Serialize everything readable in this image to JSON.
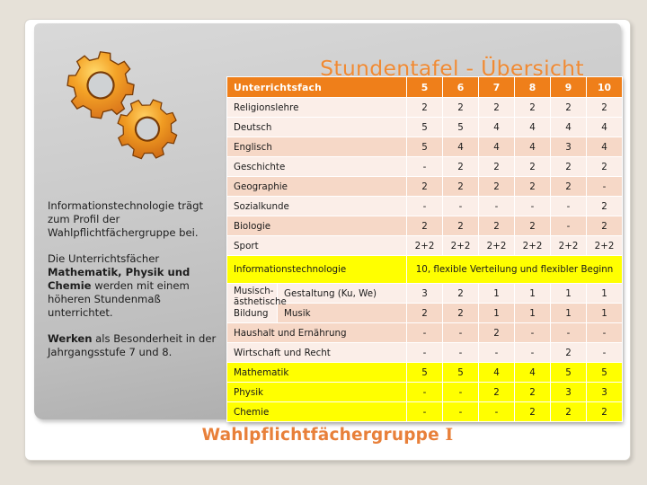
{
  "slide": {
    "title": "Stundentafel - Übersicht",
    "footer_label": "Wahlpflichtfächergruppe",
    "footer_roman": "I",
    "gears_icon": "two-gears-icon",
    "accent_orange": "#ef7f1a",
    "title_orange": "#f08a33",
    "highlight_yellow": "#ffff00",
    "row_light": "#fbeee8",
    "row_dark": "#f6d8c7"
  },
  "left_text": {
    "p1": "Informationstechnologie trägt zum Profil der Wahlpflichtfächergruppe bei.",
    "p2_pre": "Die Unterrichtsfächer ",
    "p2_bold": "Mathematik, Physik und Chemie",
    "p2_post": " werden mit einem höheren Stundenmaß unterrichtet.",
    "p3_bold": "Werken",
    "p3_post": " als Besonderheit in der Jahrgangsstufe 7 und 8."
  },
  "table": {
    "header": {
      "subject": "Unterrichtsfach",
      "grades": [
        "5",
        "6",
        "7",
        "8",
        "9",
        "10"
      ]
    },
    "rows": [
      {
        "subject": "Religionslehre",
        "values": [
          "2",
          "2",
          "2",
          "2",
          "2",
          "2"
        ]
      },
      {
        "subject": "Deutsch",
        "values": [
          "5",
          "5",
          "4",
          "4",
          "4",
          "4"
        ]
      },
      {
        "subject": "Englisch",
        "values": [
          "5",
          "4",
          "4",
          "4",
          "3",
          "4"
        ]
      },
      {
        "subject": "Geschichte",
        "values": [
          "-",
          "2",
          "2",
          "2",
          "2",
          "2"
        ]
      },
      {
        "subject": "Geographie",
        "values": [
          "2",
          "2",
          "2",
          "2",
          "2",
          "-"
        ]
      },
      {
        "subject": "Sozialkunde",
        "values": [
          "-",
          "-",
          "-",
          "-",
          "-",
          "2"
        ]
      },
      {
        "subject": "Biologie",
        "values": [
          "2",
          "2",
          "2",
          "2",
          "-",
          "2"
        ]
      },
      {
        "subject": "Sport",
        "values": [
          "2+2",
          "2+2",
          "2+2",
          "2+2",
          "2+2",
          "2+2"
        ]
      }
    ],
    "it_row": {
      "subject": "Informationstechnologie",
      "note": "10, flexible Verteilung und flexibler Beginn"
    },
    "music_group": {
      "label": "Musisch-ästhetische Bildung",
      "rows": [
        {
          "subject": "Gestaltung (Ku, We)",
          "values": [
            "3",
            "2",
            "1",
            "1",
            "1",
            "1"
          ]
        },
        {
          "subject": "Musik",
          "values": [
            "2",
            "2",
            "1",
            "1",
            "1",
            "1"
          ]
        }
      ]
    },
    "rows_tail": [
      {
        "subject": "Haushalt und Ernährung",
        "values": [
          "-",
          "-",
          "2",
          "-",
          "-",
          "-"
        ]
      },
      {
        "subject": "Wirtschaft und Recht",
        "values": [
          "-",
          "-",
          "-",
          "-",
          "2",
          "-"
        ]
      }
    ],
    "rows_yellow": [
      {
        "subject": "Mathematik",
        "values": [
          "5",
          "5",
          "4",
          "4",
          "5",
          "5"
        ]
      },
      {
        "subject": "Physik",
        "values": [
          "-",
          "-",
          "2",
          "2",
          "3",
          "3"
        ]
      },
      {
        "subject": "Chemie",
        "values": [
          "-",
          "-",
          "-",
          "2",
          "2",
          "2"
        ]
      }
    ]
  }
}
